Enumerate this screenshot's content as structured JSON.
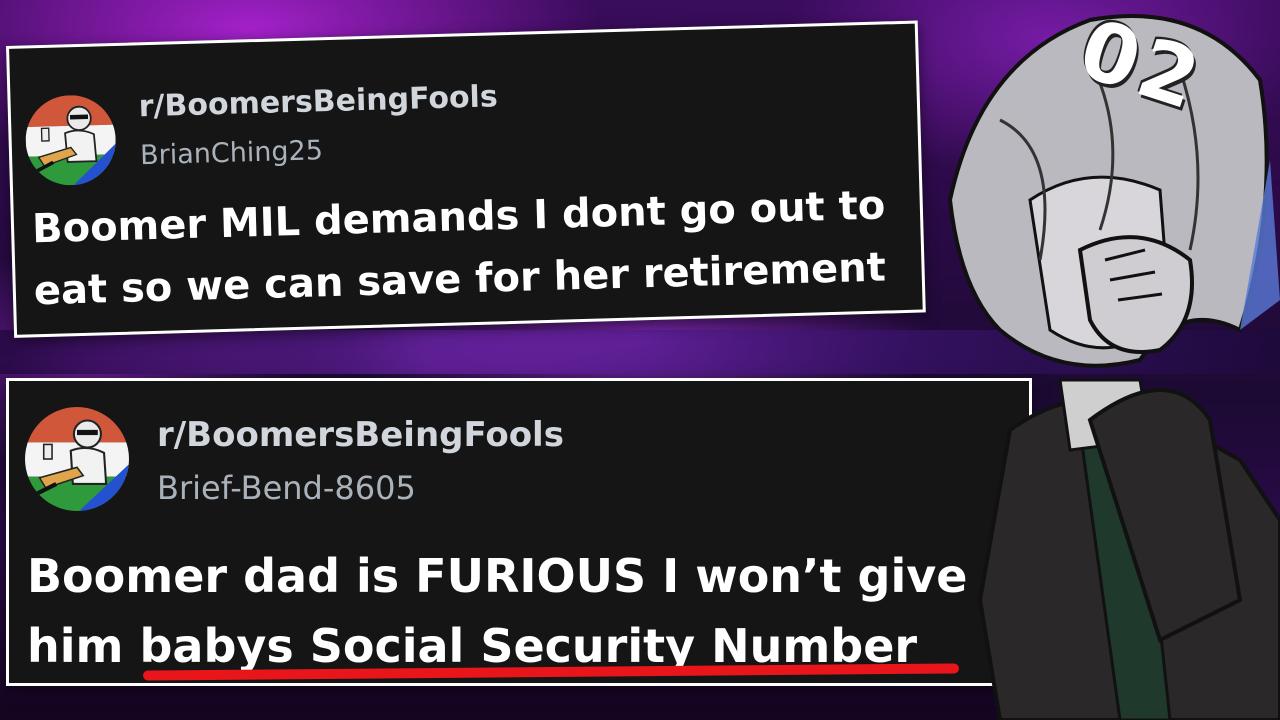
{
  "posts": [
    {
      "subreddit": "r/BoomersBeingFools",
      "username": "BrianChing25",
      "title_line1": "Boomer MIL demands I dont go out to",
      "title_line2": "eat so we can save for her retirement",
      "avatar_icon": "boomer-avatar-icon"
    },
    {
      "subreddit": "r/BoomersBeingFools",
      "username": "Brief-Bend-8605",
      "title_line1": "Boomer dad is FURIOUS I won’t give",
      "title_line2_prefix": "him ",
      "title_line2_highlight": "babys Social Security Number",
      "avatar_icon": "boomer-avatar-icon"
    }
  ],
  "episode_number": "02",
  "colors": {
    "card_bg": "#151515",
    "underline": "#e8151b",
    "background_accent": "#b43cff"
  }
}
